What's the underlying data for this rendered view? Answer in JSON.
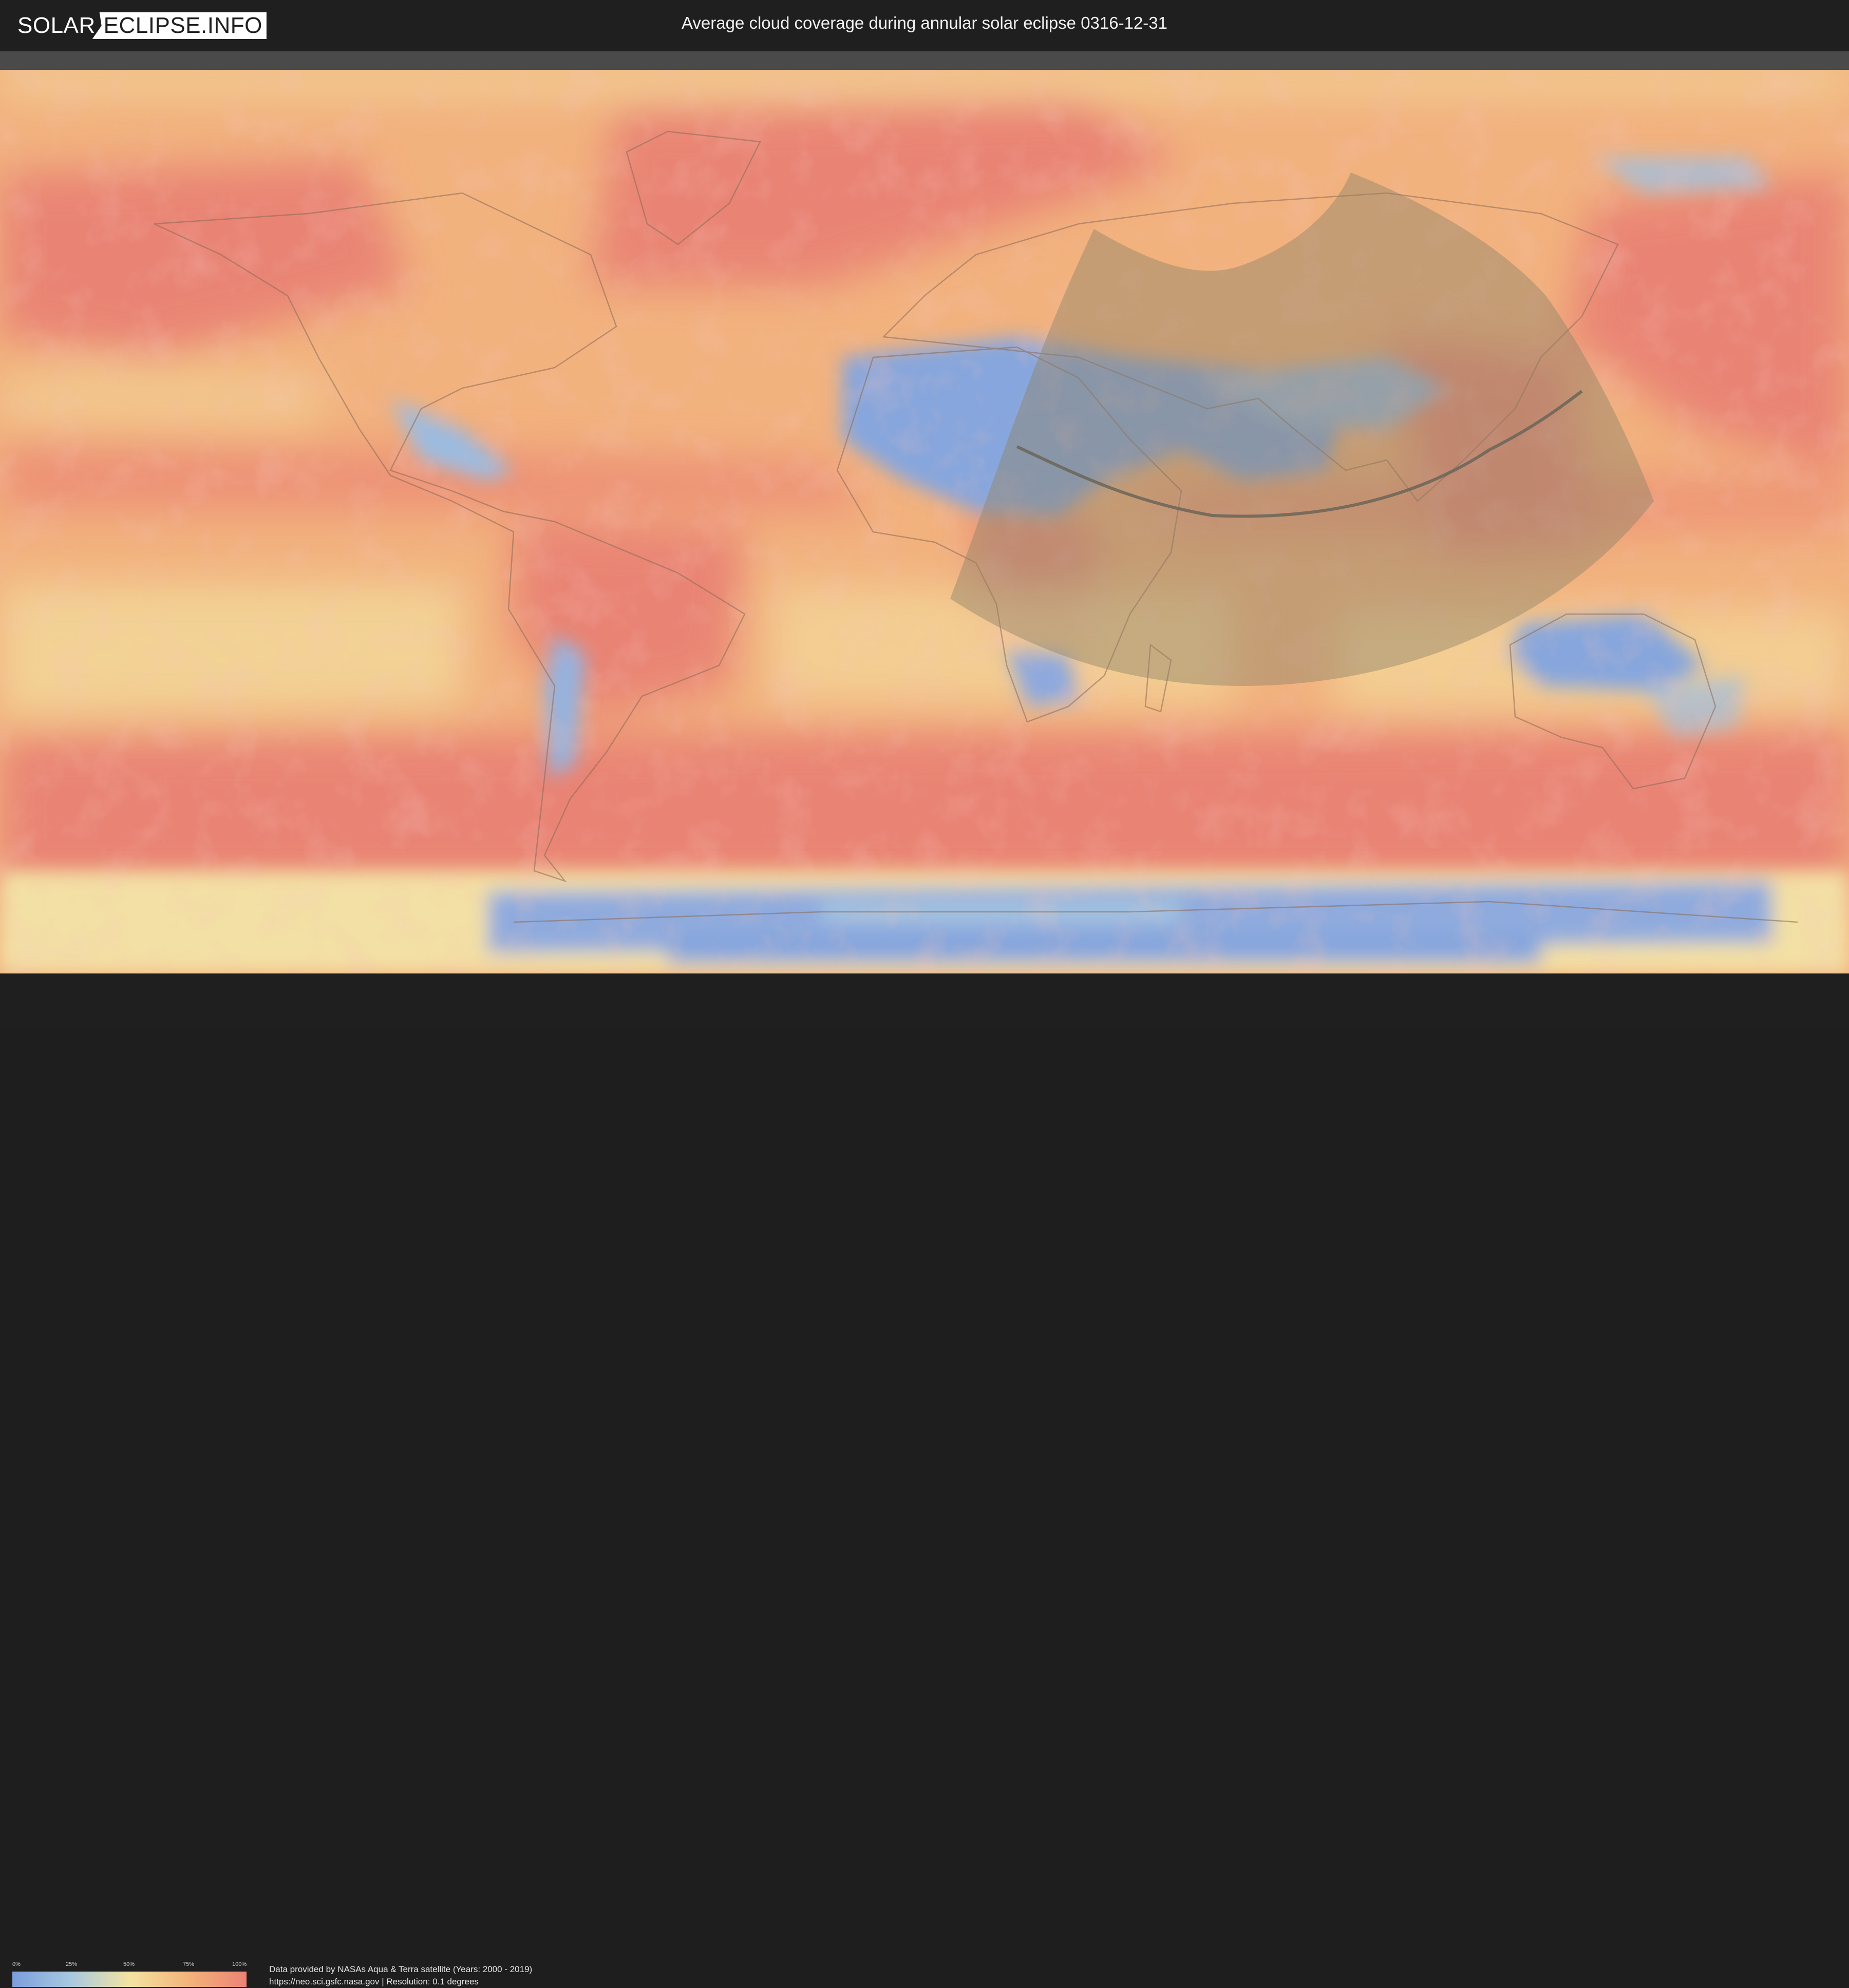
{
  "header": {
    "logo_left": "SOLAR",
    "logo_right": "ECLIPSE.INFO",
    "title": "Average cloud coverage during annular solar eclipse 0316-12-31"
  },
  "legend": {
    "ticks": [
      "0%",
      "25%",
      "50%",
      "75%",
      "100%"
    ],
    "colors": [
      "#7b9edd",
      "#a7c9e0",
      "#f3e3a1",
      "#f3b47a",
      "#ec8275"
    ]
  },
  "credits": {
    "line1": "Data provided by NASAs Aqua & Terra satellite (Years: 2000 - 2019)",
    "line2": "https://neo.sci.gsfc.nasa.gov | Resolution: 0.1 degrees"
  },
  "map": {
    "background_color": "#f2b27e",
    "cloudy_color": "#e98475",
    "clear_color": "#86a6dd",
    "eclipse_zone_color": "#8d8368",
    "path_color": "#6b6558"
  }
}
